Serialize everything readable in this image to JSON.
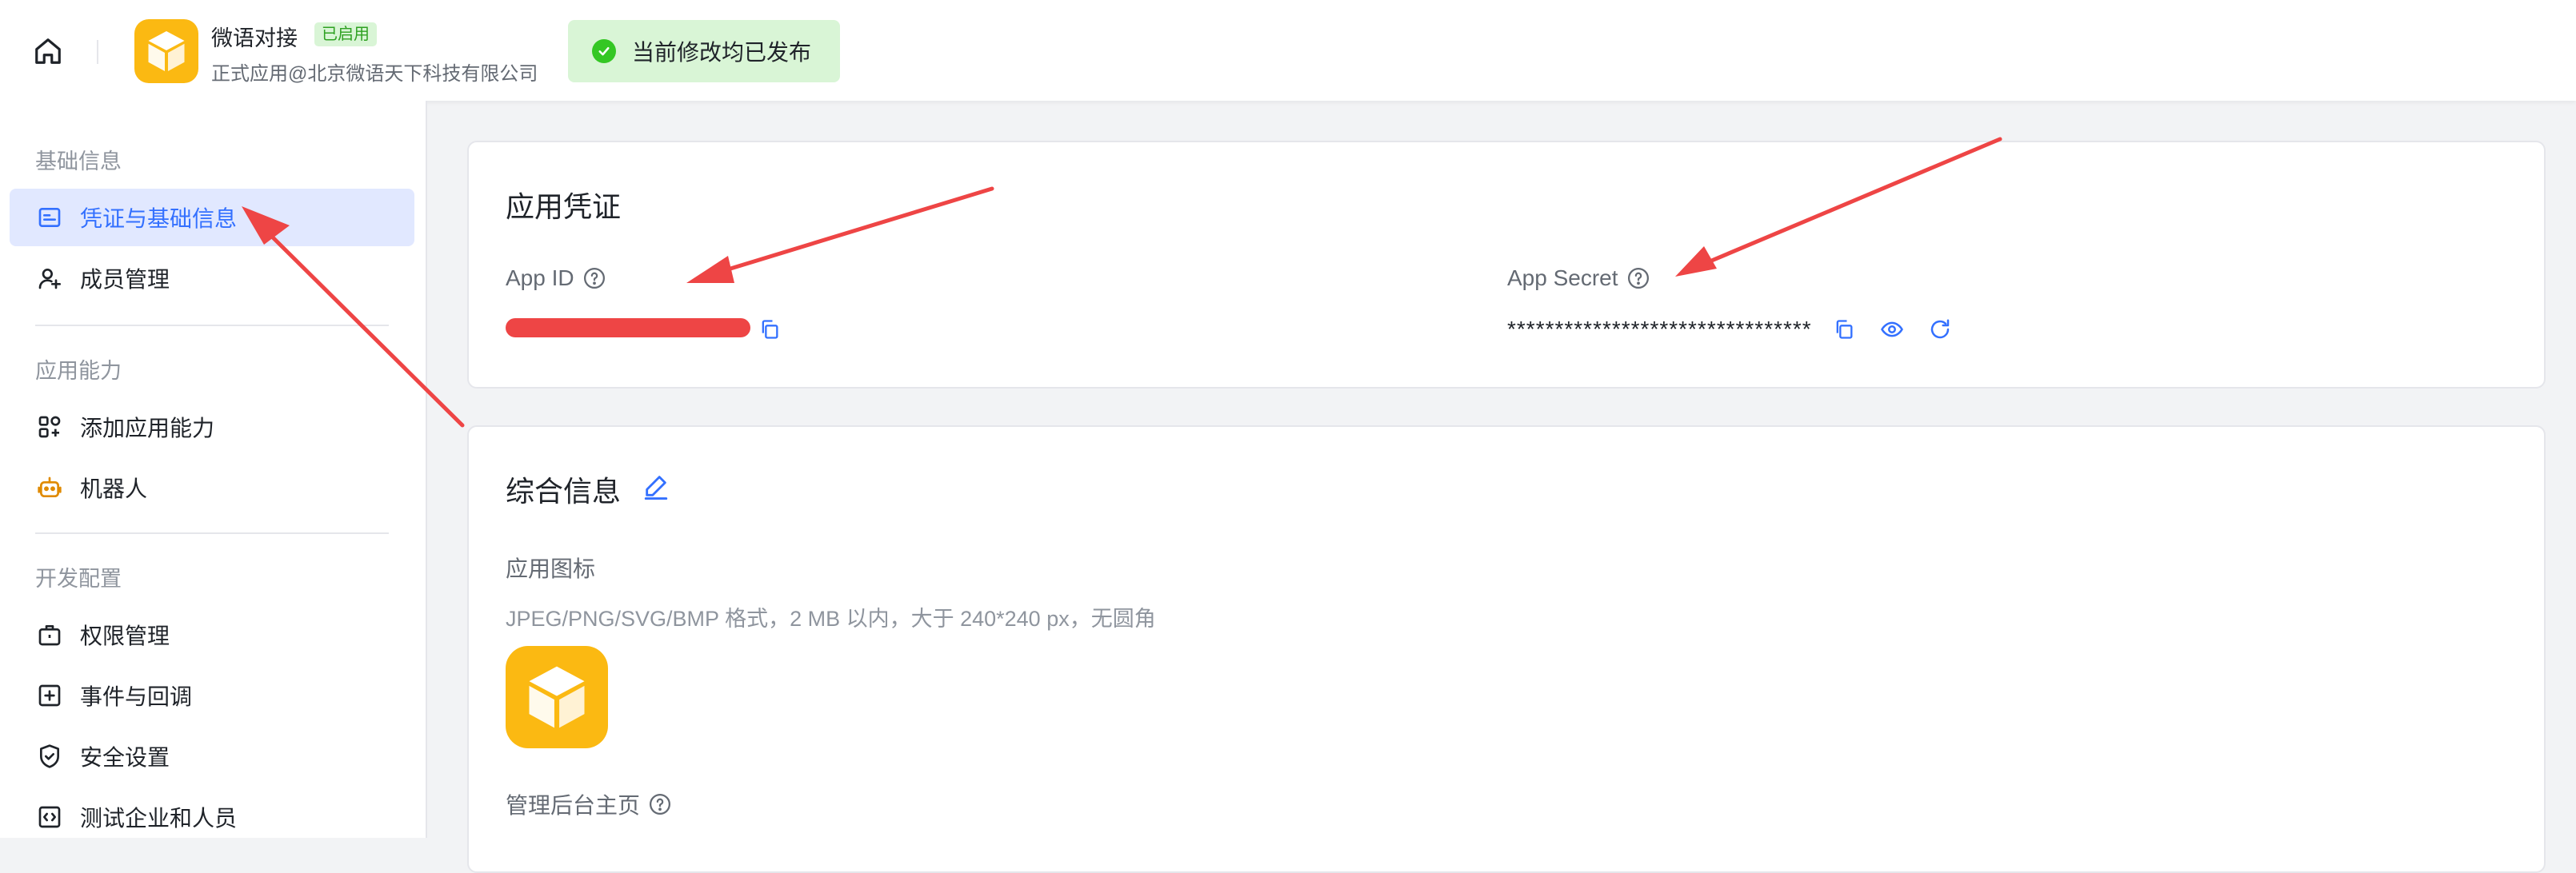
{
  "header": {
    "app_name": "微语对接",
    "status_badge": "已启用",
    "app_subtitle": "正式应用@北京微语天下科技有限公司",
    "publish_status": "当前修改均已发布"
  },
  "sidebar": {
    "groups": [
      {
        "title": "基础信息",
        "items": [
          {
            "label": "凭证与基础信息",
            "icon": "credential-card-icon",
            "active": true
          },
          {
            "label": "成员管理",
            "icon": "add-user-icon",
            "active": false
          }
        ]
      },
      {
        "title": "应用能力",
        "items": [
          {
            "label": "添加应用能力",
            "icon": "apps-grid-icon",
            "active": false
          },
          {
            "label": "机器人",
            "icon": "robot-icon",
            "active": false
          }
        ]
      },
      {
        "title": "开发配置",
        "items": [
          {
            "label": "权限管理",
            "icon": "briefcase-lock-icon",
            "active": false
          },
          {
            "label": "事件与回调",
            "icon": "event-plus-icon",
            "active": false
          },
          {
            "label": "安全设置",
            "icon": "shield-check-icon",
            "active": false
          },
          {
            "label": "测试企业和人员",
            "icon": "code-box-icon",
            "active": false
          }
        ]
      }
    ]
  },
  "credentials": {
    "title": "应用凭证",
    "app_id_label": "App ID",
    "app_secret_label": "App Secret",
    "app_secret_value": "********************************"
  },
  "general": {
    "title": "综合信息",
    "icon_label": "应用图标",
    "icon_hint": "JPEG/PNG/SVG/BMP 格式，2 MB 以内，大于 240*240 px，无圆角",
    "admin_home_label": "管理后台主页"
  },
  "colors": {
    "accent": "#3370ff",
    "brand_yellow": "#fbb912",
    "success": "#34c724",
    "annotation_red": "#ee4545"
  }
}
